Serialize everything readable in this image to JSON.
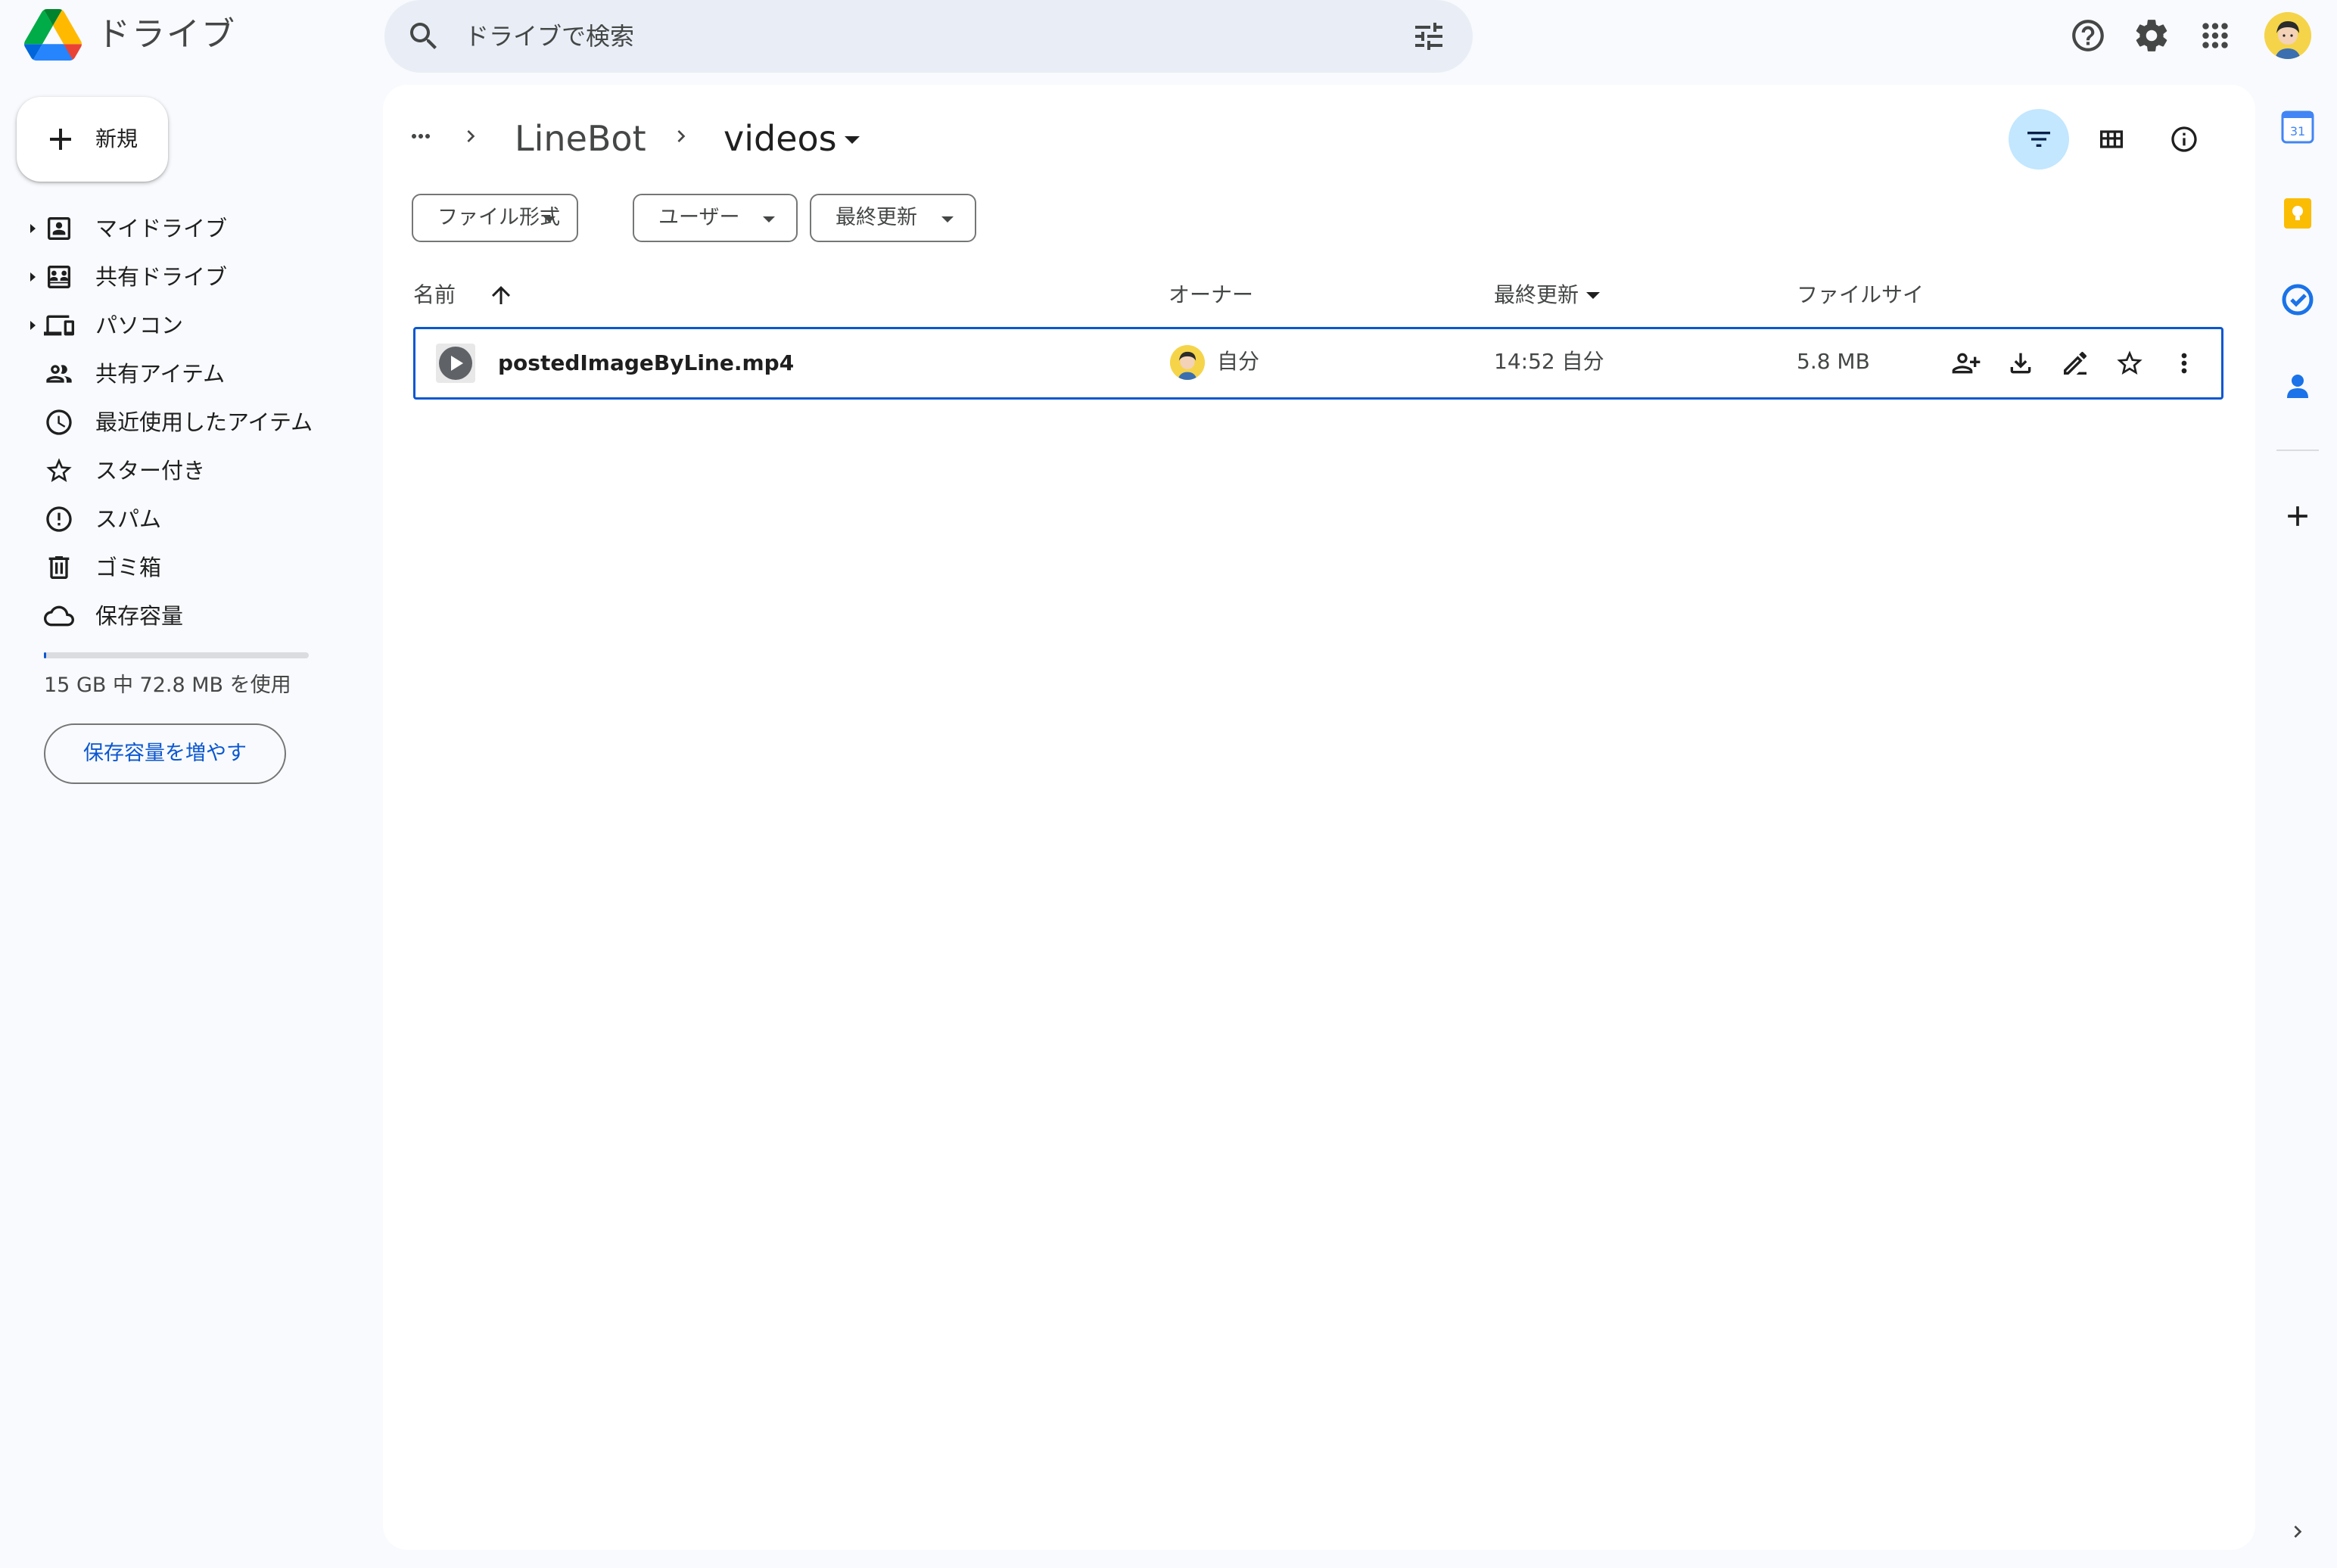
{
  "header": {
    "app_title": "ドライブ",
    "search_placeholder": "ドライブで検索",
    "icons": [
      "drive-logo",
      "search-icon",
      "tune-icon",
      "help-icon",
      "settings-icon",
      "apps-icon",
      "account-avatar"
    ]
  },
  "sidebar": {
    "new_label": "新規",
    "items": [
      {
        "label": "マイドライブ",
        "icon": "my-drive-icon",
        "expandable": true
      },
      {
        "label": "共有ドライブ",
        "icon": "shared-drive-icon",
        "expandable": true
      },
      {
        "label": "パソコン",
        "icon": "computer-icon",
        "expandable": true
      },
      {
        "label": "共有アイテム",
        "icon": "people-icon",
        "expandable": false
      },
      {
        "label": "最近使用したアイテム",
        "icon": "clock-icon",
        "expandable": false
      },
      {
        "label": "スター付き",
        "icon": "star-icon",
        "expandable": false
      },
      {
        "label": "スパム",
        "icon": "spam-icon",
        "expandable": false
      },
      {
        "label": "ゴミ箱",
        "icon": "trash-icon",
        "expandable": false
      },
      {
        "label": "保存容量",
        "icon": "cloud-icon",
        "expandable": false
      }
    ],
    "storage_text": "15 GB 中 72.8 MB を使用",
    "storage_used_fraction": 0.005,
    "upgrade_label": "保存容量を増やす"
  },
  "breadcrumb": {
    "items": [
      "LineBot",
      "videos"
    ]
  },
  "filters": {
    "chips": [
      "ファイル形式",
      "ユーザー",
      "最終更新"
    ]
  },
  "table": {
    "columns": {
      "name": "名前",
      "owner": "オーナー",
      "modified": "最終更新",
      "size": "ファイルサイ"
    },
    "rows": [
      {
        "name": "postedImageByLine.mp4",
        "type_icon": "video-icon",
        "owner": "自分",
        "modified": "14:52 自分",
        "size": "5.8 MB",
        "actions": [
          "share-icon",
          "download-icon",
          "rename-icon",
          "star-icon",
          "more-vert-icon"
        ]
      }
    ]
  },
  "side_panel": {
    "apps": [
      "calendar-icon",
      "keep-icon",
      "tasks-icon",
      "contacts-icon",
      "add-icon"
    ],
    "calendar_day": "31"
  },
  "colors": {
    "accent": "#0b57d0",
    "background": "#f8fafd",
    "panel": "#ffffff",
    "search_bg": "#e9eef6",
    "active_toggle": "#c2e7ff"
  }
}
